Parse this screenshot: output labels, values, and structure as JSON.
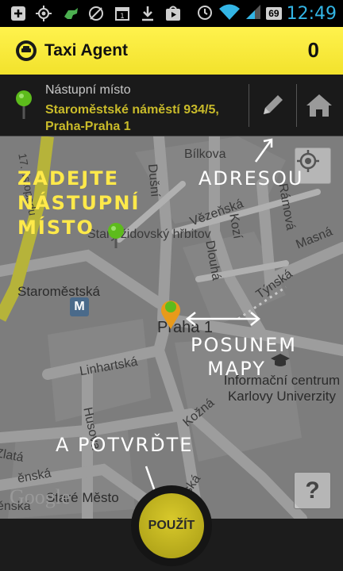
{
  "status_bar": {
    "battery": "69",
    "time": "12:49",
    "icons": [
      "plus-icon",
      "gps-icon",
      "android-icon",
      "no-signal-icon",
      "calendar-icon",
      "download-icon",
      "play-store-icon",
      "alarm-icon",
      "wifi-icon",
      "signal-icon",
      "battery-icon"
    ]
  },
  "app": {
    "title": "Taxi Agent",
    "counter": "0",
    "logo_icon": "taxi-agent-logo-icon"
  },
  "pickup": {
    "label": "Nástupní místo",
    "address": "Staroměstské náměstí 934/5, Praha-Praha 1",
    "pin_icon": "green-pin-icon",
    "edit_icon": "pencil-icon",
    "home_icon": "home-icon"
  },
  "map": {
    "streets": [
      "Bílkova",
      "Dušní",
      "Vězeňská",
      "Kozí",
      "Rámová",
      "Dlouhá",
      "Týnská",
      "Masná",
      "Linhartská",
      "Husova",
      "Kožná",
      "Zlatá",
      "ěnská",
      "ěnská",
      "ská",
      "17. listopadu"
    ],
    "places": [
      "Staroměstská",
      "Praha 1",
      "Informační centrum Karlovy Univerzity",
      "Staré Město",
      "Starý židovský hřbitov"
    ],
    "attribution": "Google",
    "metro": "M",
    "help_label": "?"
  },
  "annotations": {
    "enter_pickup": [
      "ZADEJTE",
      "NÁSTUPNÍ",
      "MÍSTO"
    ],
    "address": "ADRESOU",
    "map_move": [
      "POSUNEM",
      "MAPY"
    ],
    "confirm": "A POTVRĎTE"
  },
  "use_button": "POUŽÍT",
  "colors": {
    "header_yellow": "#f7ea36",
    "address_gold": "#c9bb2a",
    "time_blue": "#33b5e5",
    "pin_green": "#5dbb1c",
    "pin_orange": "#e89a1a"
  }
}
